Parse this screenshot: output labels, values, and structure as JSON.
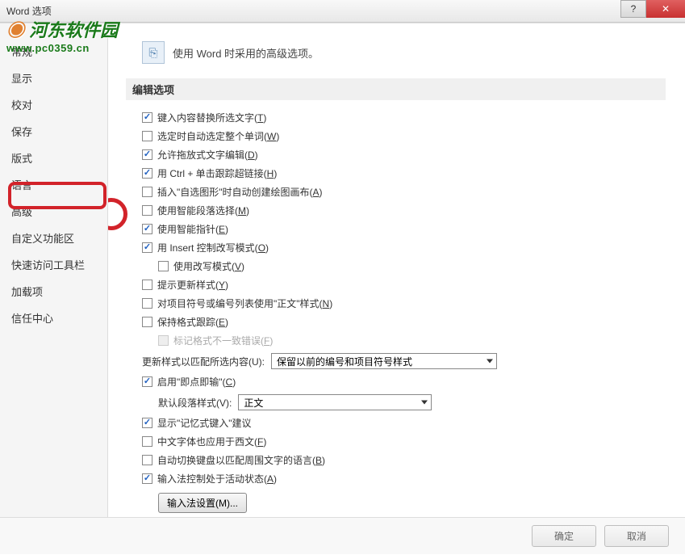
{
  "window": {
    "title": "Word 选项"
  },
  "watermark": {
    "logo_text": "河东软件园",
    "url": "www.pc0359.cn"
  },
  "sidebar": {
    "items": [
      {
        "label": "常规"
      },
      {
        "label": "显示"
      },
      {
        "label": "校对"
      },
      {
        "label": "保存"
      },
      {
        "label": "版式"
      },
      {
        "label": "语言"
      },
      {
        "label": "高级"
      },
      {
        "label": "自定义功能区"
      },
      {
        "label": "快速访问工具栏"
      },
      {
        "label": "加载项"
      },
      {
        "label": "信任中心"
      }
    ]
  },
  "content": {
    "header_text": "使用 Word 时采用的高级选项。",
    "section_title": "编辑选项",
    "options": [
      {
        "checked": true,
        "label": "键入内容替换所选文字(T)",
        "indent": 0
      },
      {
        "checked": false,
        "label": "选定时自动选定整个单词(W)",
        "indent": 0
      },
      {
        "checked": true,
        "label": "允许拖放式文字编辑(D)",
        "indent": 0
      },
      {
        "checked": true,
        "label": "用 Ctrl + 单击跟踪超链接(H)",
        "indent": 0
      },
      {
        "checked": false,
        "label": "插入\"自选图形\"时自动创建绘图画布(A)",
        "indent": 0
      },
      {
        "checked": false,
        "label": "使用智能段落选择(M)",
        "indent": 0,
        "highlight": true
      },
      {
        "checked": true,
        "label": "使用智能指针(E)",
        "indent": 0
      },
      {
        "checked": true,
        "label": "用 Insert 控制改写模式(O)",
        "indent": 0
      },
      {
        "checked": false,
        "label": "使用改写模式(V)",
        "indent": 1
      },
      {
        "checked": false,
        "label": "提示更新样式(Y)",
        "indent": 0
      },
      {
        "checked": false,
        "label": "对项目符号或编号列表使用\"正文\"样式(N)",
        "indent": 0
      },
      {
        "checked": false,
        "label": "保持格式跟踪(E)",
        "indent": 0
      },
      {
        "checked": false,
        "label": "标记格式不一致错误(F)",
        "indent": 1,
        "disabled": true
      }
    ],
    "update_style_label": "更新样式以匹配所选内容(U):",
    "update_style_value": "保留以前的编号和项目符号样式",
    "options2": [
      {
        "checked": true,
        "label": "启用\"即点即输\"(C)",
        "indent": 0
      }
    ],
    "default_para_label": "默认段落样式(V):",
    "default_para_value": "正文",
    "options3": [
      {
        "checked": true,
        "label": "显示\"记忆式键入\"建议",
        "indent": 0
      },
      {
        "checked": false,
        "label": "中文字体也应用于西文(F)",
        "indent": 0
      },
      {
        "checked": false,
        "label": "自动切换键盘以匹配周围文字的语言(B)",
        "indent": 0
      },
      {
        "checked": true,
        "label": "输入法控制处于活动状态(A)",
        "indent": 0
      }
    ],
    "ime_button": "输入法设置(M)..."
  },
  "footer": {
    "ok": "确定",
    "cancel": "取消"
  }
}
